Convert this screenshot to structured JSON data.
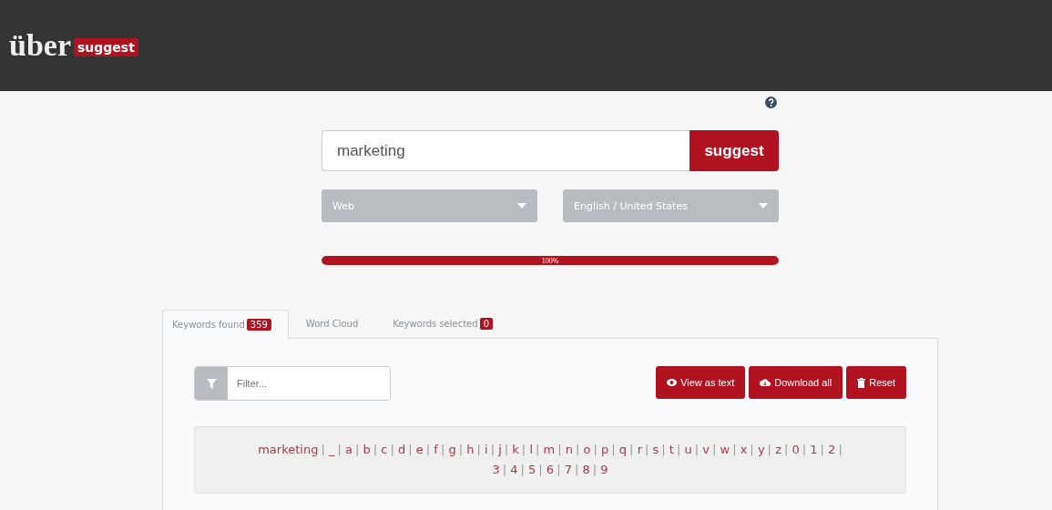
{
  "header": {
    "logo_main": "über",
    "logo_badge": "suggest"
  },
  "search": {
    "value": "marketing",
    "button": "suggest"
  },
  "dropdowns": [
    {
      "value": "Web"
    },
    {
      "value": "English / United States"
    }
  ],
  "progress": {
    "level": 1,
    "reading": "100%"
  },
  "tabs": [
    {
      "label": "Keywords found",
      "badge": "359",
      "selected": true
    },
    {
      "label": "Word Cloud",
      "selected": false
    },
    {
      "label": "Keywords selected",
      "badge": "0",
      "selected": false
    }
  ],
  "filter": {
    "placeholder": "Filter..."
  },
  "actions": [
    {
      "kind": "view",
      "label": "View as text"
    },
    {
      "kind": "download",
      "label": "Download all"
    },
    {
      "kind": "reset",
      "label": "Reset"
    }
  ],
  "letters": {
    "separator": "|",
    "items": [
      "marketing",
      "_",
      "a",
      "b",
      "c",
      "d",
      "e",
      "f",
      "g",
      "h",
      "i",
      "j",
      "k",
      "l",
      "m",
      "n",
      "o",
      "p",
      "q",
      "r",
      "s",
      "t",
      "u",
      "v",
      "w",
      "x",
      "y",
      "z",
      "0",
      "1",
      "2",
      "3",
      "4",
      "5",
      "6",
      "7",
      "8",
      "9"
    ]
  }
}
